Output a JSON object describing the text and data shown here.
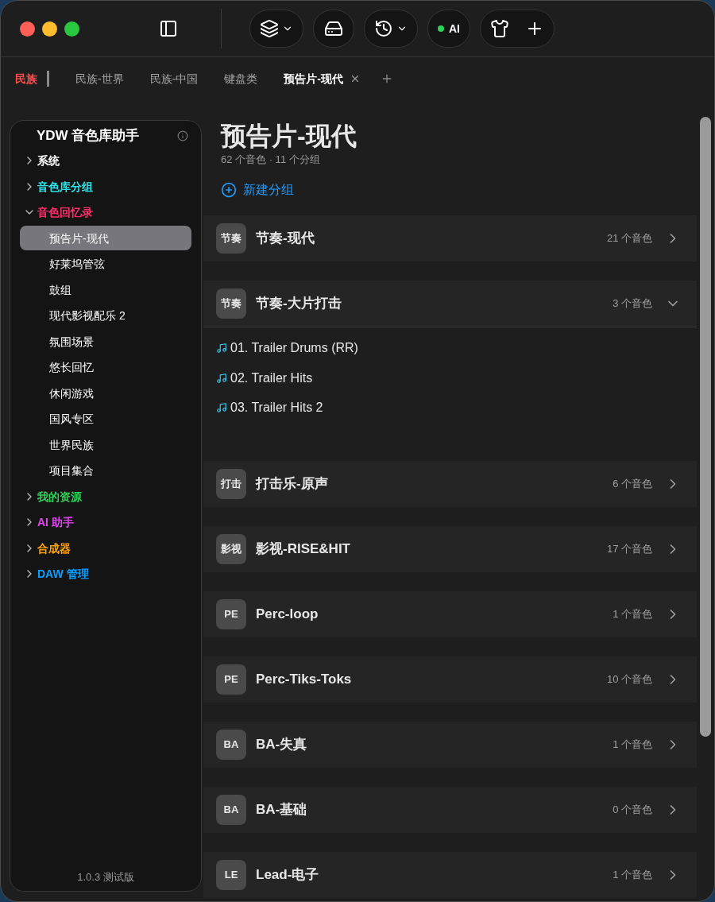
{
  "toolbar": {
    "ai_label": "AI"
  },
  "tabs": [
    {
      "label": "民族",
      "kind": "pinned",
      "selected": false
    },
    {
      "label": "民族-世界",
      "kind": "tab",
      "selected": false
    },
    {
      "label": "民族-中国",
      "kind": "tab",
      "selected": false
    },
    {
      "label": "键盘类",
      "kind": "tab",
      "selected": false
    },
    {
      "label": "预告片-现代",
      "kind": "tab",
      "selected": true
    }
  ],
  "sidebar": {
    "title": "YDW 音色库助手",
    "version": "1.0.3 测试版",
    "items": [
      {
        "label": "系统",
        "color": "#ffffff",
        "expanded": false
      },
      {
        "label": "音色库分组",
        "color": "#2de2e6",
        "expanded": false
      },
      {
        "label": "音色回忆录",
        "color": "#ff2d6a",
        "expanded": true,
        "children": [
          {
            "label": "预告片-现代",
            "selected": true
          },
          {
            "label": "好莱坞管弦",
            "selected": false
          },
          {
            "label": "鼓组",
            "selected": false
          },
          {
            "label": "现代影视配乐 2",
            "selected": false
          },
          {
            "label": "氛围场景",
            "selected": false
          },
          {
            "label": "悠长回忆",
            "selected": false
          },
          {
            "label": "休闲游戏",
            "selected": false
          },
          {
            "label": "国风专区",
            "selected": false
          },
          {
            "label": "世界民族",
            "selected": false
          },
          {
            "label": "项目集合",
            "selected": false
          }
        ]
      },
      {
        "label": "我的资源",
        "color": "#30d158",
        "expanded": false
      },
      {
        "label": "AI 助手",
        "color": "#e046f0",
        "expanded": false
      },
      {
        "label": "合成器",
        "color": "#ff9f0a",
        "expanded": false
      },
      {
        "label": "DAW 管理",
        "color": "#0a9eff",
        "expanded": false
      }
    ]
  },
  "main": {
    "title": "预告片-现代",
    "subtitle": "62 个音色 · 11 个分组",
    "new_group": "新建分组",
    "groups": [
      {
        "badge": "节奏",
        "name": "节奏-现代",
        "count": "21 个音色",
        "expanded": false
      },
      {
        "badge": "节奏",
        "name": "节奏-大片打击",
        "count": "3 个音色",
        "expanded": true,
        "tracks": [
          "01. Trailer Drums (RR)",
          "02. Trailer Hits",
          "03. Trailer Hits 2"
        ]
      },
      {
        "badge": "打击",
        "name": "打击乐-原声",
        "count": "6 个音色",
        "expanded": false
      },
      {
        "badge": "影视",
        "name": "影视-RISE&HIT",
        "count": "17 个音色",
        "expanded": false
      },
      {
        "badge": "PE",
        "name": "Perc-loop",
        "count": "1 个音色",
        "expanded": false
      },
      {
        "badge": "PE",
        "name": "Perc-Tiks-Toks",
        "count": "10 个音色",
        "expanded": false
      },
      {
        "badge": "BA",
        "name": "BA-失真",
        "count": "1 个音色",
        "expanded": false
      },
      {
        "badge": "BA",
        "name": "BA-基础",
        "count": "0 个音色",
        "expanded": false
      },
      {
        "badge": "LE",
        "name": "Lead-电子",
        "count": "1 个音色",
        "expanded": false
      }
    ]
  }
}
